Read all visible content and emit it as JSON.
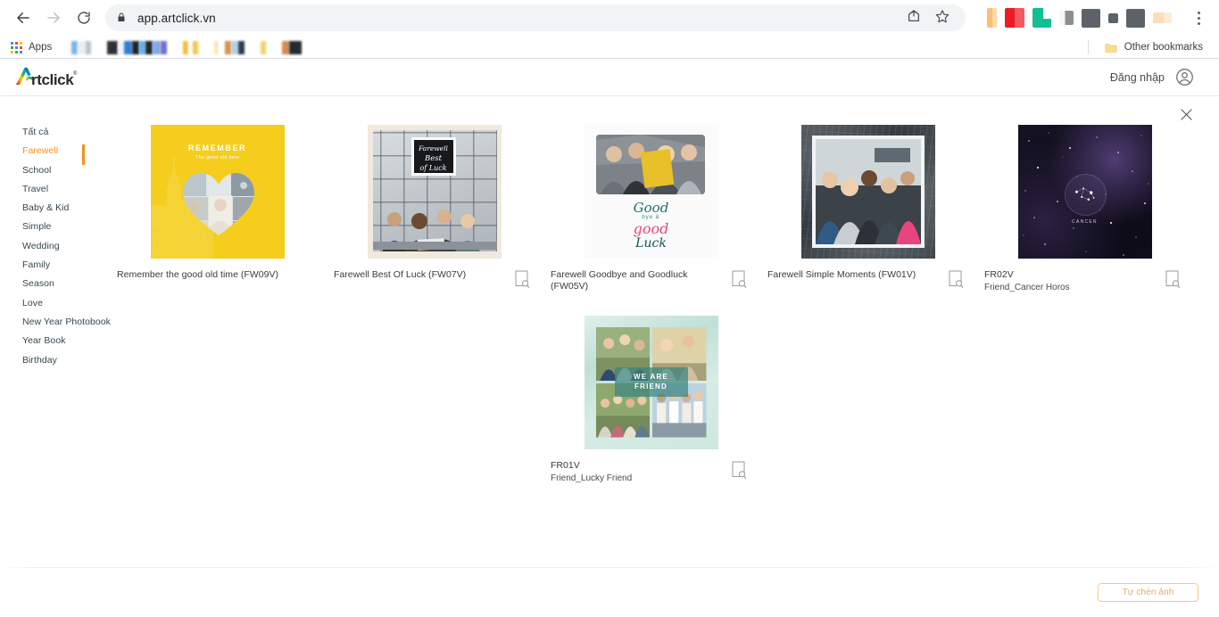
{
  "browser": {
    "url": "app.artclick.vn",
    "back_icon": "back-arrow-icon",
    "forward_icon": "forward-arrow-icon",
    "reload_icon": "reload-icon",
    "lock_icon": "lock-icon",
    "share_icon": "share-icon",
    "bookmark_icon": "star-icon",
    "menu_icon": "three-dot-menu-icon",
    "apps_label": "Apps",
    "other_bookmarks_label": "Other bookmarks"
  },
  "header": {
    "logo_text": "rtclick",
    "logo_mark": "A",
    "trademark": "®",
    "login_label": "Đăng nhập",
    "avatar_icon": "user-avatar-icon"
  },
  "content": {
    "close_icon": "close-icon"
  },
  "sidebar": {
    "items": [
      {
        "label": "Tất cả",
        "active": false
      },
      {
        "label": "Farewell",
        "active": true
      },
      {
        "label": "School",
        "active": false
      },
      {
        "label": "Travel",
        "active": false
      },
      {
        "label": "Baby & Kid",
        "active": false
      },
      {
        "label": "Simple",
        "active": false
      },
      {
        "label": "Wedding",
        "active": false
      },
      {
        "label": "Family",
        "active": false
      },
      {
        "label": "Season",
        "active": false
      },
      {
        "label": "Love",
        "active": false
      },
      {
        "label": "New Year Photobook",
        "active": false
      },
      {
        "label": "Year Book",
        "active": false
      },
      {
        "label": "Birthday",
        "active": false
      }
    ],
    "active_color": "#f5911e"
  },
  "cards": [
    {
      "title": "Remember the good old time (FW09V)",
      "subtitle": "",
      "art": "remember",
      "art_text": {
        "line1": "REMEMBER",
        "line2": "The good old time"
      },
      "preview_icon": "preview-magnifier-icon"
    },
    {
      "title": "Farewell Best Of Luck (FW07V)",
      "subtitle": "",
      "art": "bestluck",
      "art_text": {
        "line1": "Farewell",
        "line2": "Best",
        "line3": "of Luck"
      },
      "preview_icon": "preview-magnifier-icon"
    },
    {
      "title": "Farewell Goodbye and Goodluck (FW05V)",
      "subtitle": "",
      "art": "goodbye",
      "art_text": {
        "line1": "Good",
        "line2": "bye &",
        "line3": "good",
        "line4": "Luck"
      },
      "preview_icon": "preview-magnifier-icon"
    },
    {
      "title": "Farewell Simple Moments (FW01V)",
      "subtitle": "",
      "art": "simple",
      "art_text": {},
      "preview_icon": "preview-magnifier-icon"
    },
    {
      "title": "FR02V",
      "subtitle": "Friend_Cancer Horos",
      "art": "cancer",
      "art_text": {
        "line1": "CANCER"
      },
      "preview_icon": "preview-magnifier-icon"
    },
    {
      "title": "FR01V",
      "subtitle": "Friend_Lucky Friend",
      "art": "friend",
      "art_text": {
        "line1": "WE ARE",
        "line2": "FRIEND"
      },
      "preview_icon": "preview-magnifier-icon"
    }
  ],
  "footer": {
    "insert_button_label": "Tự chèn ảnh",
    "insert_button_color": "#e0ab6b"
  }
}
